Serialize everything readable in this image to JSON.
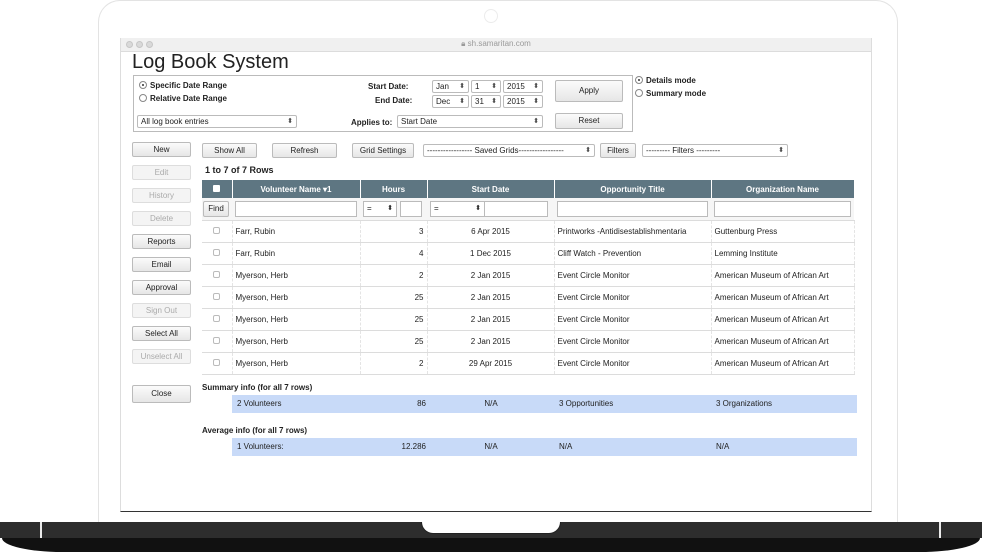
{
  "browser": {
    "url": "sh.samaritan.com"
  },
  "page": {
    "title": "Log Book System"
  },
  "filters": {
    "specific_range": "Specific Date Range",
    "relative_range": "Relative Date Range",
    "log_select": "All log book entries",
    "start_label": "Start Date:",
    "end_label": "End Date:",
    "start": {
      "month": "Jan",
      "day": "1",
      "year": "2015"
    },
    "end": {
      "month": "Dec",
      "day": "31",
      "year": "2015"
    },
    "applies_label": "Applies to:",
    "applies_value": "Start Date",
    "apply": "Apply",
    "reset": "Reset",
    "details_mode": "Details mode",
    "summary_mode": "Summary mode"
  },
  "toolbar": {
    "show_all": "Show All",
    "refresh": "Refresh",
    "grid_settings": "Grid Settings",
    "saved_grids": "----------------- Saved Grids-----------------",
    "filters_btn": "Filters",
    "filters_select": "--------- Filters ---------"
  },
  "side": [
    "New",
    "Edit",
    "History",
    "Delete",
    "Reports",
    "Email",
    "Approval",
    "Sign Out",
    "Select All",
    "Unselect All",
    "Close"
  ],
  "grid": {
    "row_count": "1 to 7 of 7 Rows",
    "headers": [
      "Volunteer Name ▾1",
      "Hours",
      "Start Date",
      "Opportunity Title",
      "Organization Name"
    ],
    "find": "Find",
    "hours_op": "=",
    "date_op": "=",
    "rows": [
      [
        "Farr, Rubin",
        "3",
        "6 Apr 2015",
        "Printworks -Antidisestablishmentaria",
        "Guttenburg Press"
      ],
      [
        "Farr, Rubin",
        "4",
        "1 Dec 2015",
        "Cliff  Watch - Prevention",
        "Lemming Institute"
      ],
      [
        "Myerson, Herb",
        "2",
        "2 Jan 2015",
        "Event Circle Monitor",
        "American Museum of African Art"
      ],
      [
        "Myerson, Herb",
        "25",
        "2 Jan 2015",
        "Event Circle Monitor",
        "American Museum of African Art"
      ],
      [
        "Myerson, Herb",
        "25",
        "2 Jan 2015",
        "Event Circle Monitor",
        "American Museum of African Art"
      ],
      [
        "Myerson, Herb",
        "25",
        "2 Jan 2015",
        "Event Circle Monitor",
        "American Museum of African Art"
      ],
      [
        "Myerson, Herb",
        "2",
        "29 Apr 2015",
        "Event Circle Monitor",
        "American Museum of African Art"
      ]
    ]
  },
  "summary": {
    "label": "Summary info (for all 7 rows)",
    "volunteers": "2 Volunteers",
    "hours": "86",
    "date": "N/A",
    "opportunities": "3 Opportunities",
    "organizations": "3 Organizations"
  },
  "average": {
    "label": "Average info (for all 7 rows)",
    "volunteers": "1 Volunteers:",
    "hours": "12.286",
    "date": "N/A",
    "opportunities": "N/A",
    "organizations": "N/A"
  }
}
